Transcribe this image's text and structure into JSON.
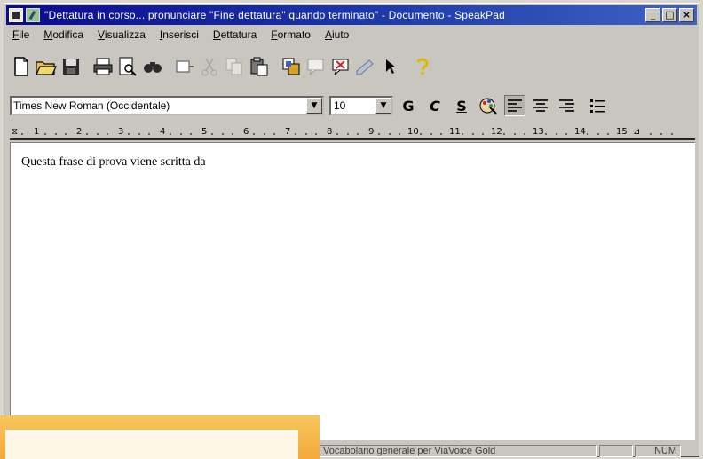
{
  "window": {
    "title": "\"Dettatura in corso... pronunciare \"Fine dettatura\" quando terminato\" - Documento - SpeakPad",
    "min_label": "_",
    "max_label": "□",
    "close_label": "×"
  },
  "menu": [
    {
      "label": "File"
    },
    {
      "label": "Modifica"
    },
    {
      "label": "Visualizza"
    },
    {
      "label": "Inserisci"
    },
    {
      "label": "Dettatura"
    },
    {
      "label": "Formato"
    },
    {
      "label": "Aiuto"
    }
  ],
  "toolbar": {
    "icons": [
      "new-document-icon",
      "open-folder-icon",
      "save-icon",
      "print-icon",
      "print-preview-icon",
      "find-binoculars-icon",
      "insert-icon",
      "cut-icon",
      "copy-icon",
      "paste-icon",
      "dictation-icon",
      "comment-icon",
      "comment-delete-icon",
      "edit-icon",
      "pointer-icon",
      "help-icon"
    ]
  },
  "format": {
    "font_value": "Times New Roman (Occidentale)",
    "size_value": "10",
    "bold_label": "G",
    "italic_label": "C",
    "underline_label": "S"
  },
  "ruler": {
    "numbers": [
      "1",
      "2",
      "3",
      "4",
      "5",
      "6",
      "7",
      "8",
      "9",
      "10",
      "11",
      "12",
      "13",
      "14",
      "15"
    ]
  },
  "document": {
    "text": "Questa frase di prova viene scritta da"
  },
  "status": {
    "vocabulary": "Vocabolario generale per ViaVoice Gold",
    "num": "NUM"
  },
  "colors": {
    "titlebar_start": "#0a0a8e",
    "titlebar_end": "#3f63c2",
    "overlay_orange": "#f2a93a"
  }
}
